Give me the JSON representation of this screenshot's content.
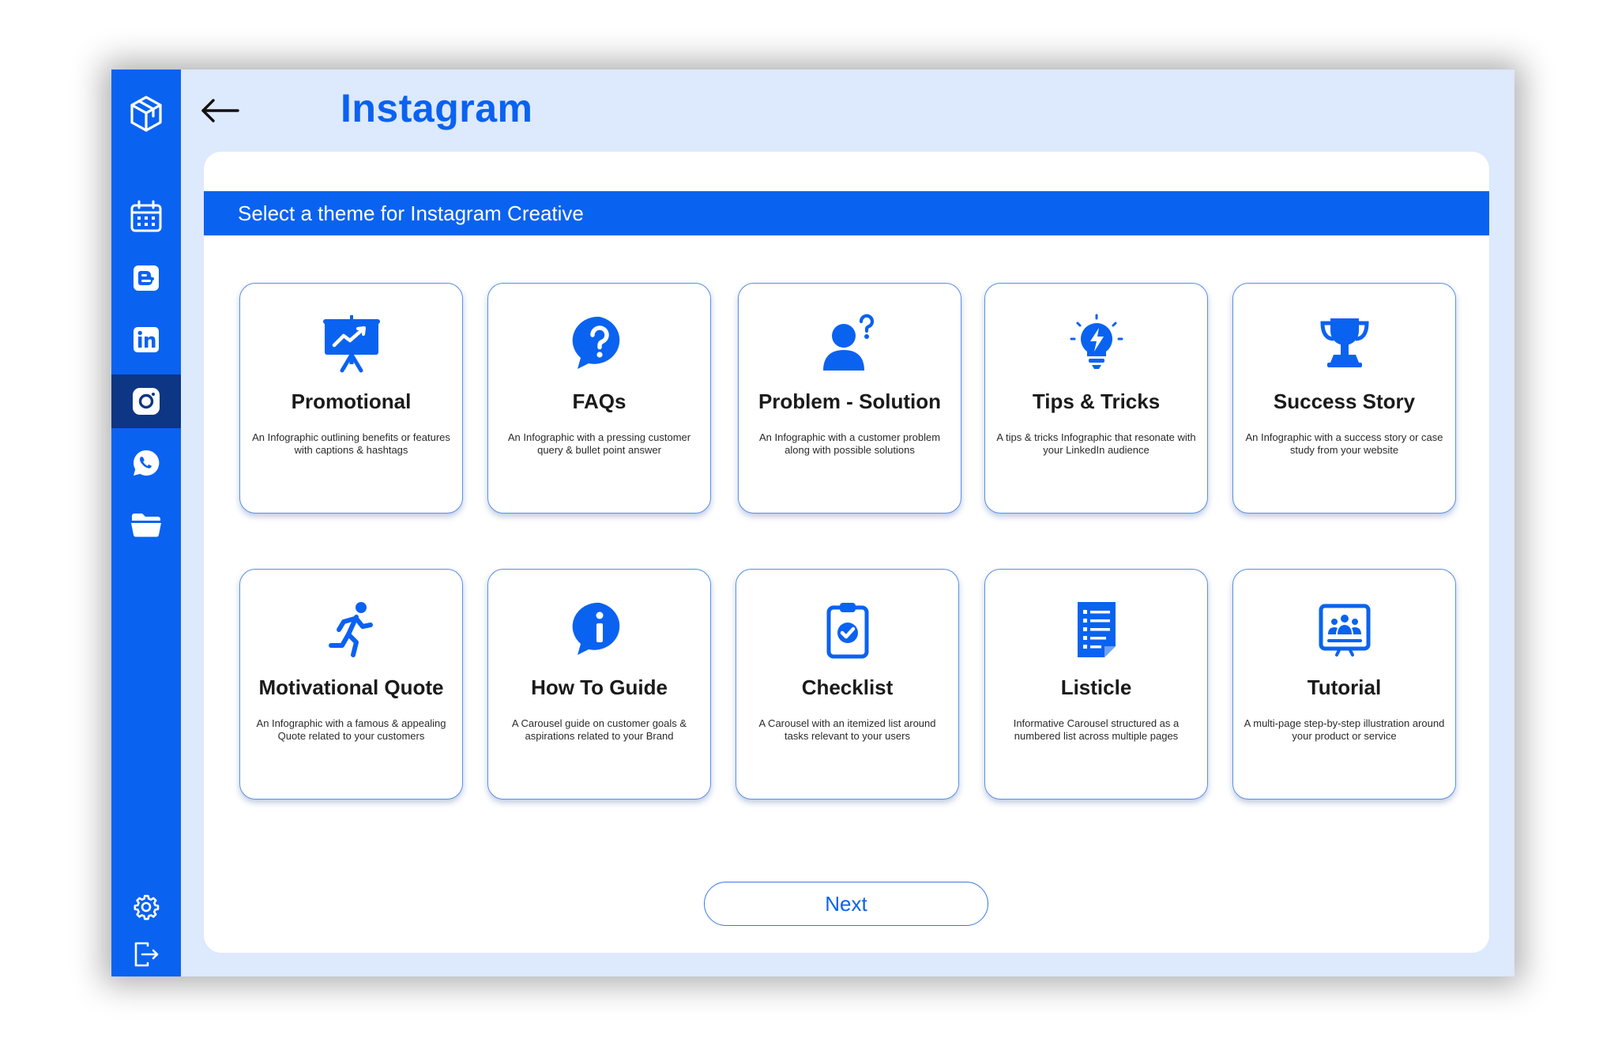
{
  "header": {
    "title": "Instagram"
  },
  "panel": {
    "heading": "Select a theme for Instagram Creative"
  },
  "sidebar": {
    "items": [
      {
        "icon": "logo-cube-icon"
      },
      {
        "icon": "calendar-icon"
      },
      {
        "icon": "blogger-icon"
      },
      {
        "icon": "linkedin-icon"
      },
      {
        "icon": "instagram-icon",
        "active": true
      },
      {
        "icon": "whatsapp-icon"
      },
      {
        "icon": "folder-icon"
      },
      {
        "icon": "gear-icon"
      },
      {
        "icon": "logout-icon"
      }
    ]
  },
  "themes": [
    {
      "title": "Promotional",
      "desc": "An Infographic outlining benefits or features with captions & hashtags",
      "icon": "presentation-chart-icon"
    },
    {
      "title": "FAQs",
      "desc": "An Infographic with a pressing customer query & bullet point answer",
      "icon": "question-bubble-icon"
    },
    {
      "title": "Problem - Solution",
      "desc": "An Infographic with a customer problem along with possible solutions",
      "icon": "person-question-icon"
    },
    {
      "title": "Tips & Tricks",
      "desc": "A tips & tricks Infographic that resonate with your LinkedIn audience",
      "icon": "lightbulb-bolt-icon"
    },
    {
      "title": "Success Story",
      "desc": "An Infographic with a success story or case study from your website",
      "icon": "trophy-icon"
    },
    {
      "title": "Motivational Quote",
      "desc": "An Infographic with a famous & appealing Quote related to your customers",
      "icon": "running-person-icon"
    },
    {
      "title": "How To Guide",
      "desc": "A Carousel guide on customer goals & aspirations related to your Brand",
      "icon": "info-bubble-icon"
    },
    {
      "title": "Checklist",
      "desc": "A Carousel with an itemized list around tasks relevant to your users",
      "icon": "clipboard-check-icon"
    },
    {
      "title": "Listicle",
      "desc": "Informative Carousel structured as a numbered list across multiple pages",
      "icon": "list-document-icon"
    },
    {
      "title": "Tutorial",
      "desc": "A multi-page step-by-step illustration around your product or service",
      "icon": "presentation-group-icon"
    }
  ],
  "footer": {
    "next_label": "Next"
  },
  "colors": {
    "brand_blue": "#0a62f0",
    "sidebar_active": "#0d3684",
    "window_bg": "#dde9fc"
  }
}
